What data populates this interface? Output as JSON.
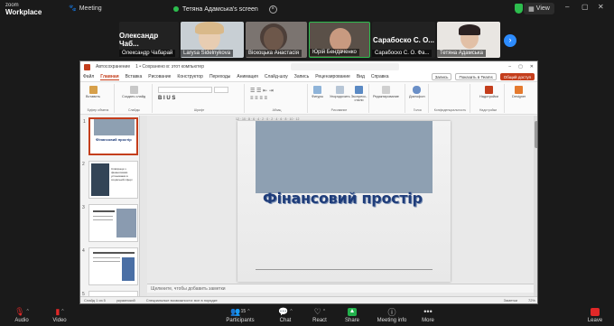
{
  "app": {
    "brand_line1": "zoom",
    "brand_line2": "Workplace",
    "meeting_label": "Meeting"
  },
  "share_pill": {
    "text": "Тетяна Адамська's screen"
  },
  "topbar": {
    "view_label": "View"
  },
  "participants": [
    {
      "name": "Олександр Чабарай",
      "big": "Олександр Чаб...",
      "type": "text"
    },
    {
      "name": "Larysa Sidelnykova",
      "type": "video"
    },
    {
      "name": "Віскоцька Анастасія",
      "type": "video"
    },
    {
      "name": "Юрій Бендаченко",
      "type": "video",
      "active": true
    },
    {
      "name": "Сарабоско С. О. Фа...",
      "big": "Сарабоско С. О...",
      "type": "text"
    },
    {
      "name": "Тетяна Адамська",
      "type": "video"
    }
  ],
  "shared_window": {
    "title": "Автосохранение",
    "file_title": "1 • Сохранено в: этот компьютер",
    "menu": [
      "Файл",
      "Главная",
      "Вставка",
      "Рисование",
      "Конструктор",
      "Переходы",
      "Анимация",
      "Слайд-шоу",
      "Запись",
      "Рецензирование",
      "Вид",
      "Справка"
    ],
    "active_menu": "Главная",
    "record_btn": "Запись",
    "teams_btn": "Показать в Teams",
    "share_btn": "Общий доступ",
    "ribbon_groups": [
      "Буфер обмена",
      "Слайды",
      "Шрифт",
      "Абзац",
      "Рисование",
      "Голос",
      "Конфиденциальность",
      "Надстройки"
    ],
    "ribbon_buttons": [
      "Вставить",
      "Создать слайд",
      "Фигуры",
      "Упорядочить",
      "Экспресс-стили",
      "Редактирование",
      "Диктофон",
      "Надстройки",
      "Designer"
    ],
    "slide_title": "Фінансовий простір",
    "notes_placeholder": "Щелкните, чтобы добавить заметки",
    "status_left": "Слайд 1 из 5",
    "status_lang": "украинский",
    "status_access": "Специальные возможности: все в порядке",
    "status_notes": "Заметки",
    "status_zoom": "72%",
    "thumb_numbers": [
      "1",
      "2",
      "3",
      "4",
      "5"
    ],
    "thumb1_title": "Фінансовий простір",
    "thumb2_text": "Співпраця з фінансовими установами в соціальній сфері"
  },
  "toolbar": {
    "audio": "Audio",
    "video": "Video",
    "participants": "Participants",
    "participants_count": "15",
    "chat": "Chat",
    "react": "React",
    "share": "Share",
    "meeting_info": "Meeting info",
    "more": "More",
    "leave": "Leave"
  }
}
